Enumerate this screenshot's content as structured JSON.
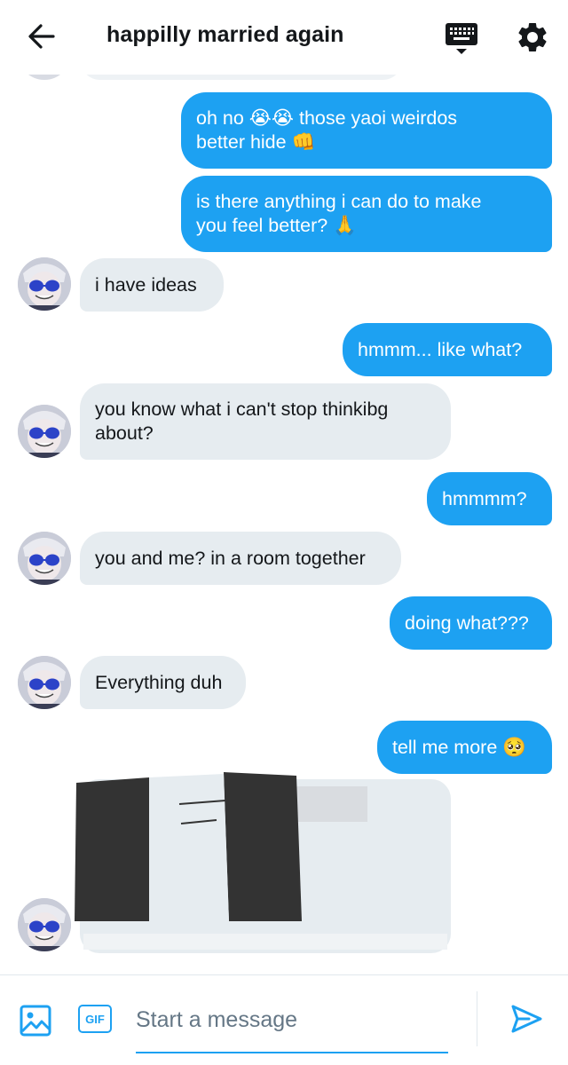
{
  "header": {
    "title": "happilly married again",
    "back_icon": "arrow-left-icon",
    "keyboard_icon": "keyboard-icon",
    "settings_icon": "gear-icon"
  },
  "messages": [
    {
      "side": "sent",
      "text": "oh no 😭😭 those yaoi weirdos\nbetter hide 👊"
    },
    {
      "side": "sent",
      "text": "is there anything i can do to make\nyou feel better? 🙏"
    },
    {
      "side": "recv",
      "text": "i have ideas"
    },
    {
      "side": "sent",
      "text": "hmmm... like what?"
    },
    {
      "side": "recv",
      "text": "you know what i can't stop thinkibg\nabout?"
    },
    {
      "side": "sent",
      "text": "hmmmm?"
    },
    {
      "side": "recv",
      "text": "you and me? in a room together"
    },
    {
      "side": "sent",
      "text": "doing what???"
    },
    {
      "side": "recv",
      "text": "Everything duh"
    },
    {
      "side": "sent",
      "text": "tell me more 🥺"
    }
  ],
  "composer": {
    "placeholder": "Start a message",
    "gif_label": "GIF",
    "image_icon": "image-icon",
    "send_icon": "send-icon"
  },
  "colors": {
    "accent": "#1da1f2",
    "received_bubble": "#e6ecf0",
    "text": "#14171a",
    "placeholder": "#657786"
  }
}
